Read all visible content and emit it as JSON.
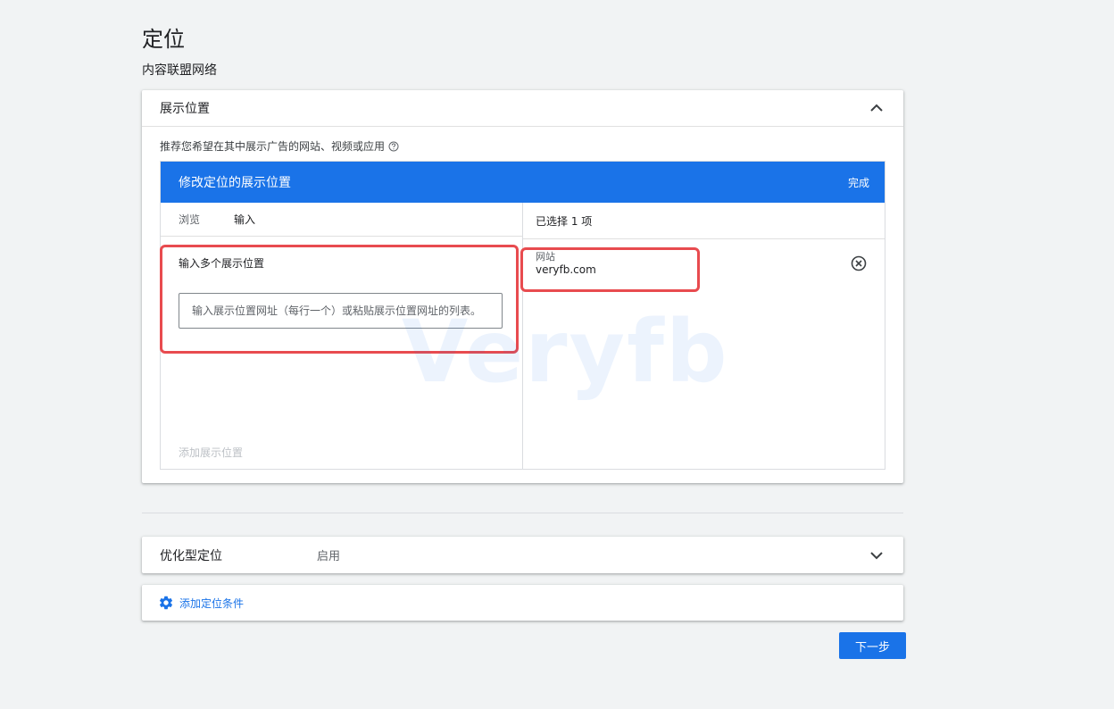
{
  "page": {
    "title": "定位",
    "subtitle": "内容联盟网络"
  },
  "placements": {
    "header_title": "展示位置",
    "recommend_text": "推荐您希望在其中展示广告的网站、视频或应用",
    "editor": {
      "title": "修改定位的展示位置",
      "done_label": "完成",
      "tabs": [
        {
          "label": "浏览",
          "active": false
        },
        {
          "label": "输入",
          "active": true
        }
      ],
      "enter_label": "输入多个展示位置",
      "input_placeholder": "输入展示位置网址（每行一个）或粘贴展示位置网址的列表。",
      "add_placement_label": "添加展示位置",
      "selected_header": "已选择 1 项",
      "selected_items": [
        {
          "type": "网站",
          "value": "veryfb.com"
        }
      ]
    }
  },
  "optimized": {
    "label": "优化型定位",
    "value": "启用"
  },
  "add_condition": {
    "label": "添加定位条件",
    "icon": "gear-icon"
  },
  "next_button": "下一步",
  "watermark": "Veryfb",
  "colors": {
    "accent": "#1a73e8",
    "highlight": "#e84b4f",
    "background": "#f1f3f4"
  }
}
